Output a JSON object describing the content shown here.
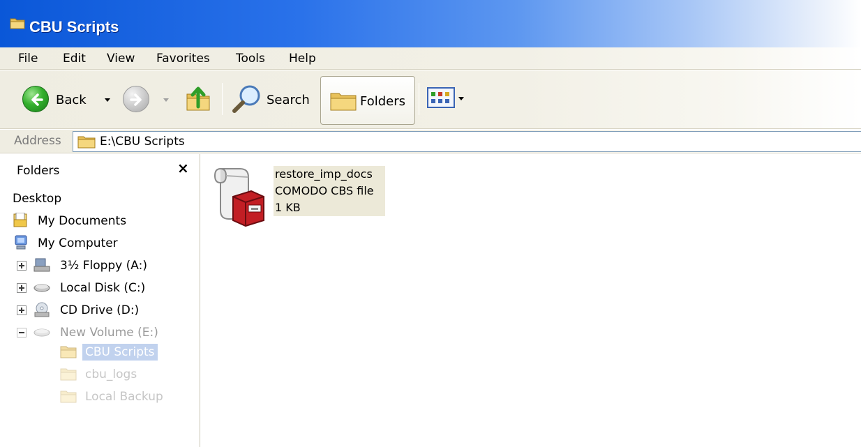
{
  "window": {
    "title": "CBU Scripts",
    "title_icon": "folder-icon"
  },
  "menu": [
    "File",
    "Edit",
    "View",
    "Favorites",
    "Tools",
    "Help"
  ],
  "toolbar": {
    "back_label": "Back",
    "search_label": "Search",
    "folders_label": "Folders",
    "icons": [
      "back-arrow-icon",
      "forward-arrow-icon",
      "up-folder-icon",
      "search-magnifier-icon",
      "folders-icon",
      "views-icon"
    ]
  },
  "address": {
    "label": "Address",
    "value": "E:\\CBU Scripts"
  },
  "folders_pane": {
    "title": "Folders",
    "close_glyph": "×",
    "tree": [
      {
        "label": "Desktop",
        "icon": "desktop-icon"
      },
      {
        "label": "My Documents",
        "icon": "my-documents-icon"
      },
      {
        "label": "My Computer",
        "icon": "my-computer-icon"
      },
      {
        "label": "3½ Floppy (A:)",
        "icon": "floppy-icon"
      },
      {
        "label": "Local Disk (C:)",
        "icon": "disk-icon"
      },
      {
        "label": "CD Drive (D:)",
        "icon": "cd-drive-icon"
      },
      {
        "label": "New Volume (E:)",
        "icon": "disk-icon"
      },
      {
        "label": "CBU Scripts",
        "icon": "folder-open-icon",
        "selected": true
      },
      {
        "label": "cbu_logs",
        "icon": "folder-icon"
      },
      {
        "label": "Local Backup",
        "icon": "folder-icon"
      }
    ]
  },
  "files": [
    {
      "name": "restore_imp_docs",
      "type": "COMODO CBS file",
      "size": "1 KB",
      "icon": "comodo-cbs-script-icon"
    }
  ]
}
